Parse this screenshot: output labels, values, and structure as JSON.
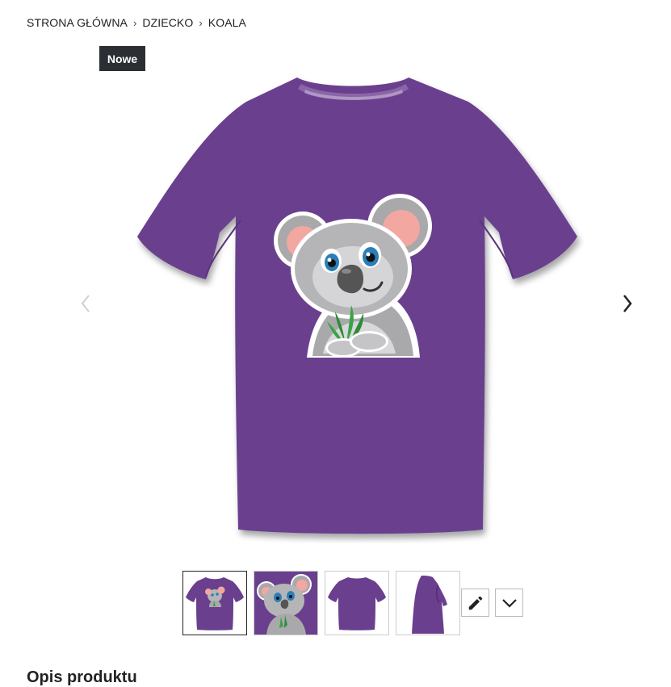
{
  "breadcrumb": {
    "items": [
      "STRONA GŁÓWNA",
      "DZIECKO",
      "KOALA"
    ]
  },
  "badge": {
    "label": "Nowe"
  },
  "product": {
    "shirt_color": "#6a3f8e",
    "shirt_shadow": "#55306f",
    "main_image_icon": "koala-tshirt-image"
  },
  "gallery": {
    "thumbnails": [
      {
        "view": "front-with-print",
        "active": true
      },
      {
        "view": "design-closeup",
        "active": false
      },
      {
        "view": "back",
        "active": false
      },
      {
        "view": "side",
        "active": false
      }
    ]
  },
  "icons": {
    "prev": "chevron-left-icon",
    "next": "chevron-right-icon",
    "edit": "pencil-icon",
    "more": "chevron-down-icon"
  },
  "section_title": "Opis produktu"
}
